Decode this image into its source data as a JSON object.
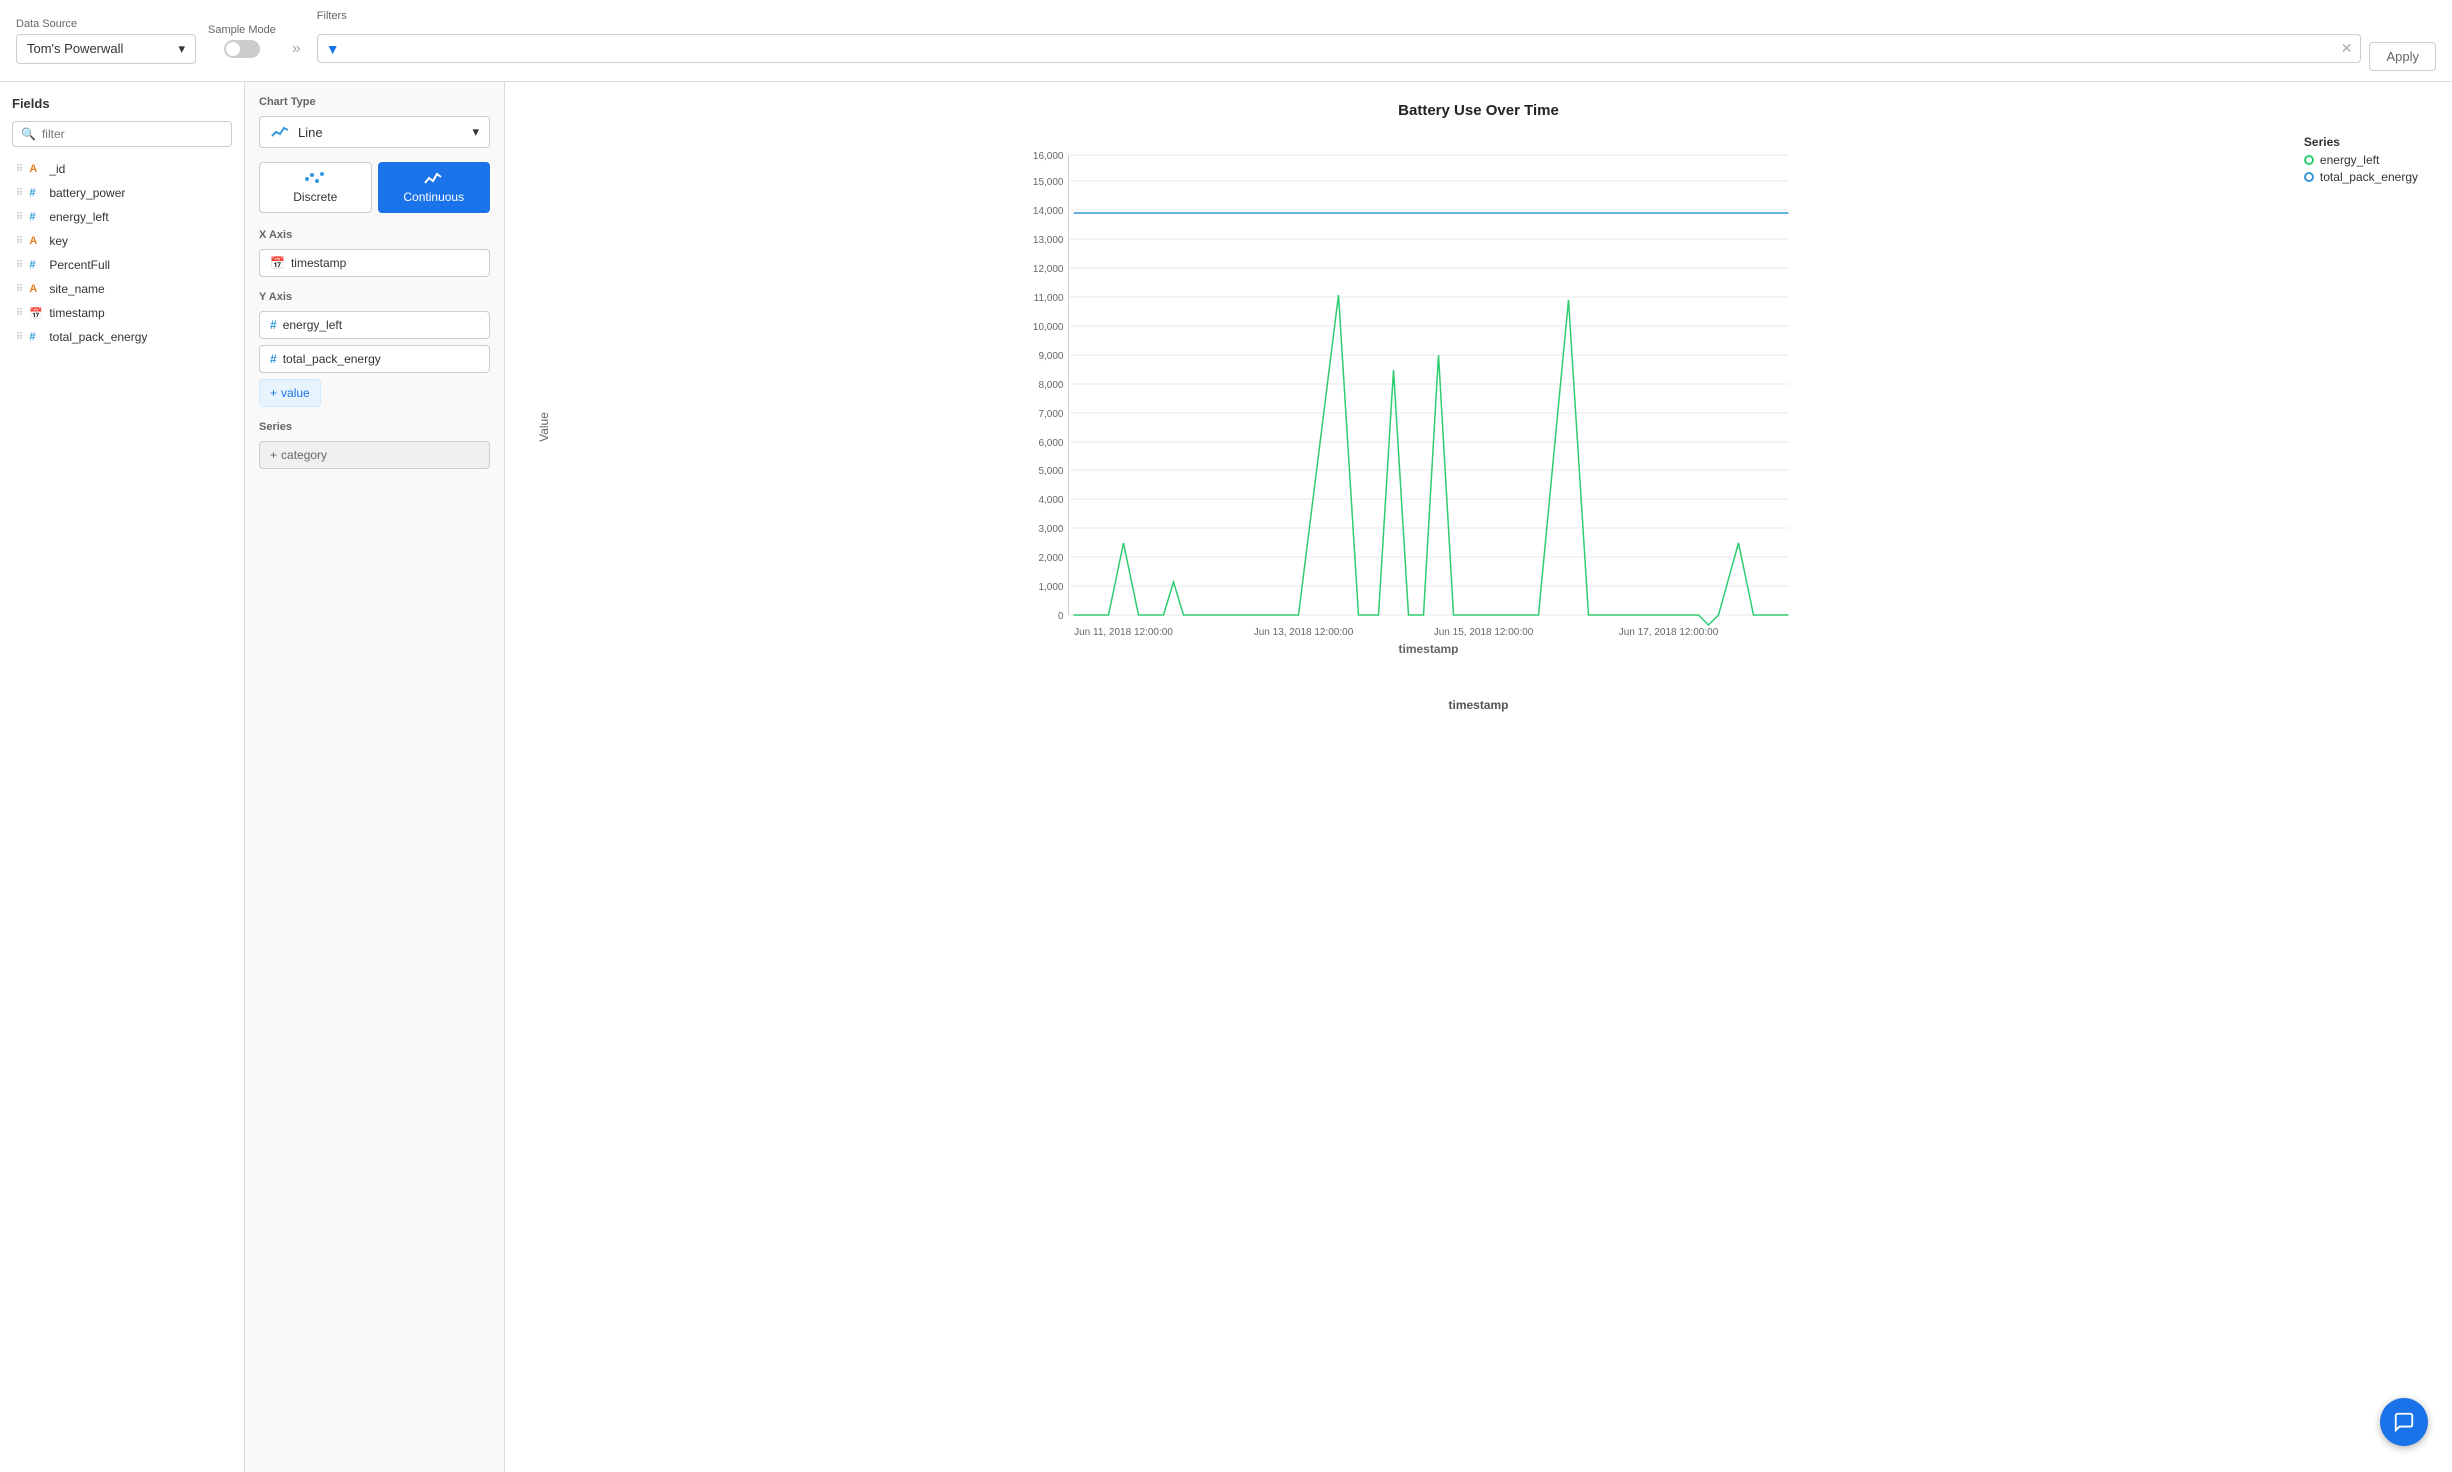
{
  "header": {
    "data_source_label": "Data Source",
    "data_source_value": "Tom's Powerwall",
    "sample_mode_label": "Sample Mode",
    "filters_label": "Filters",
    "filter_placeholder": "",
    "apply_label": "Apply"
  },
  "fields_panel": {
    "title": "Fields",
    "search_placeholder": "filter",
    "fields": [
      {
        "name": "_id",
        "type": "string",
        "icon": "A"
      },
      {
        "name": "battery_power",
        "type": "number",
        "icon": "#"
      },
      {
        "name": "energy_left",
        "type": "number",
        "icon": "#"
      },
      {
        "name": "key",
        "type": "string",
        "icon": "A"
      },
      {
        "name": "PercentFull",
        "type": "number",
        "icon": "#"
      },
      {
        "name": "site_name",
        "type": "string",
        "icon": "A"
      },
      {
        "name": "timestamp",
        "type": "calendar",
        "icon": "cal"
      },
      {
        "name": "total_pack_energy",
        "type": "number",
        "icon": "#"
      }
    ]
  },
  "config_panel": {
    "chart_type_label": "Chart Type",
    "chart_type_value": "Line",
    "discrete_label": "Discrete",
    "continuous_label": "Continuous",
    "x_axis_label": "X Axis",
    "x_axis_field": "timestamp",
    "y_axis_label": "Y Axis",
    "y_axis_fields": [
      "energy_left",
      "total_pack_energy"
    ],
    "add_value_label": "+ value",
    "series_label": "Series",
    "add_category_label": "+ category"
  },
  "chart": {
    "title": "Battery Use Over Time",
    "y_axis_label": "Value",
    "x_axis_label": "timestamp",
    "y_ticks": [
      "0",
      "1,000",
      "2,000",
      "3,000",
      "4,000",
      "5,000",
      "6,000",
      "7,000",
      "8,000",
      "9,000",
      "10,000",
      "11,000",
      "12,000",
      "13,000",
      "14,000",
      "15,000",
      "16,000"
    ],
    "x_ticks": [
      "Jun 11, 2018 12:00:00",
      "Jun 13, 2018 12:00:00",
      "Jun 15, 2018 12:00:00",
      "Jun 17, 2018 12:00:00"
    ],
    "legend": {
      "title": "Series",
      "items": [
        {
          "label": "energy_left",
          "color": "green"
        },
        {
          "label": "total_pack_energy",
          "color": "blue"
        }
      ]
    }
  },
  "colors": {
    "accent_blue": "#1a73e8",
    "green_line": "#2ecc71",
    "blue_line": "#3498db"
  }
}
